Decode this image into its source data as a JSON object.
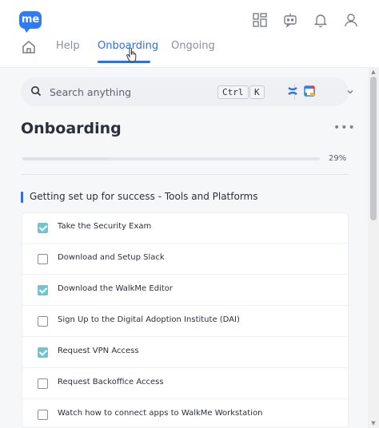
{
  "header": {
    "logo_text": "me",
    "icons": [
      "apps-grid-icon",
      "bot-icon",
      "bell-icon",
      "user-icon"
    ]
  },
  "nav": {
    "home_icon": "home-icon",
    "tabs": [
      {
        "label": "Help"
      },
      {
        "label": "Onboarding"
      },
      {
        "label": "Ongoing"
      }
    ],
    "active_tab": "Onboarding"
  },
  "search": {
    "placeholder": "Search anything",
    "shortcut_1": "Ctrl",
    "shortcut_2": "K"
  },
  "page": {
    "title": "Onboarding",
    "more_label": "•••",
    "progress_fraction": 0.29,
    "progress_text": "29%"
  },
  "section": {
    "title": "Getting set up for success - Tools and Platforms",
    "items": [
      {
        "label": "Take the Security Exam",
        "checked": true
      },
      {
        "label": "Download and Setup Slack",
        "checked": false
      },
      {
        "label": "Download the WalkMe Editor",
        "checked": true
      },
      {
        "label": "Sign Up to the Digital Adoption Institute (DAI)",
        "checked": false
      },
      {
        "label": "Request VPN Access",
        "checked": true
      },
      {
        "label": "Request Backoffice Access",
        "checked": false
      },
      {
        "label": "Watch how to connect apps to WalkMe Workstation",
        "checked": false
      }
    ]
  },
  "colors": {
    "accent": "#2f6fe0",
    "check": "#6cc5d6",
    "logo": "#2f7bf5"
  }
}
